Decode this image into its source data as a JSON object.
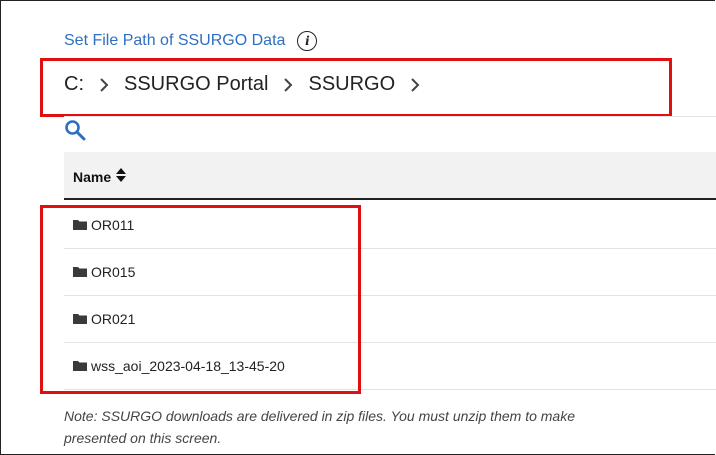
{
  "title": "Set File Path of SSURGO Data",
  "info_icon": "i",
  "breadcrumb": [
    "C:",
    "SSURGO Portal",
    "SSURGO"
  ],
  "table": {
    "header": "Name",
    "rows": [
      "OR011",
      "OR015",
      "OR021",
      "wss_aoi_2023-04-18_13-45-20"
    ]
  },
  "note": {
    "line1": "Note: SSURGO downloads are delivered in zip files. You must unzip them to make",
    "line2": "presented on this screen."
  },
  "colors": {
    "title": "#2f6fc0",
    "highlight": "#e01010",
    "search_icon": "#2f6fc0"
  },
  "icons": [
    "info-icon",
    "chevron-right-icon",
    "search-icon",
    "sort-icon",
    "folder-icon"
  ]
}
